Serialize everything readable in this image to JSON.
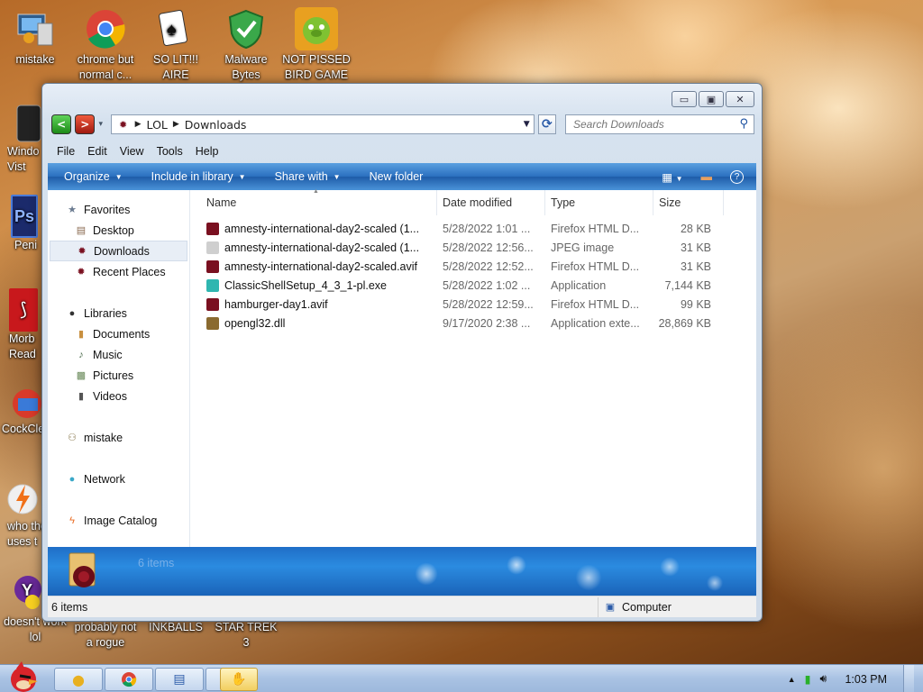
{
  "desktop": {
    "icons": [
      {
        "label": "mistake"
      },
      {
        "label": "chrome but normal c..."
      },
      {
        "label": "SO LIT!!! AIRE"
      },
      {
        "label": "Malware Bytes"
      },
      {
        "label": "NOT PISSED BIRD GAME"
      },
      {
        "label": "Windo Vist"
      },
      {
        "label": "Peni"
      },
      {
        "label": "Morb Read"
      },
      {
        "label": "CockCle"
      },
      {
        "label": "who the uses t"
      },
      {
        "label": "doesn't work lol"
      },
      {
        "label": "probably not a rogue"
      },
      {
        "label": "INKBALLS"
      },
      {
        "label": "STAR TREK 3"
      }
    ]
  },
  "window": {
    "breadcrumb": [
      "LOL",
      "Downloads"
    ],
    "search_placeholder": "Search Downloads",
    "menu": [
      "File",
      "Edit",
      "View",
      "Tools",
      "Help"
    ],
    "commands": [
      "Organize",
      "Include in library",
      "Share with",
      "New folder"
    ],
    "nav": {
      "favorites": "Favorites",
      "favorites_items": [
        "Desktop",
        "Downloads",
        "Recent Places"
      ],
      "libraries": "Libraries",
      "library_items": [
        "Documents",
        "Music",
        "Pictures",
        "Videos"
      ],
      "homegroup": "mistake",
      "network": "Network",
      "catalog": "Image Catalog"
    },
    "columns": {
      "name": "Name",
      "date": "Date modified",
      "type": "Type",
      "size": "Size"
    },
    "files": [
      {
        "name": "amnesty-international-day2-scaled (1...",
        "date": "5/28/2022 1:01 ...",
        "type": "Firefox HTML D...",
        "size": "28 KB",
        "color": "#7a1020"
      },
      {
        "name": "amnesty-international-day2-scaled (1...",
        "date": "5/28/2022 12:56...",
        "type": "JPEG image",
        "size": "31 KB",
        "color": "#cfcfcf"
      },
      {
        "name": "amnesty-international-day2-scaled.avif",
        "date": "5/28/2022 12:52...",
        "type": "Firefox HTML D...",
        "size": "31 KB",
        "color": "#7a1020"
      },
      {
        "name": "ClassicShellSetup_4_3_1-pl.exe",
        "date": "5/28/2022 1:02 ...",
        "type": "Application",
        "size": "7,144 KB",
        "color": "#2fb6b0"
      },
      {
        "name": "hamburger-day1.avif",
        "date": "5/28/2022 12:59...",
        "type": "Firefox HTML D...",
        "size": "99 KB",
        "color": "#7a1020"
      },
      {
        "name": "opengl32.dll",
        "date": "9/17/2020 2:38 ...",
        "type": "Application exte...",
        "size": "28,869 KB",
        "color": "#8a6a30"
      }
    ],
    "details_count": "6 items",
    "status_items": "6 items",
    "status_location": "Computer"
  },
  "taskbar": {
    "clock": "1:03 PM"
  }
}
